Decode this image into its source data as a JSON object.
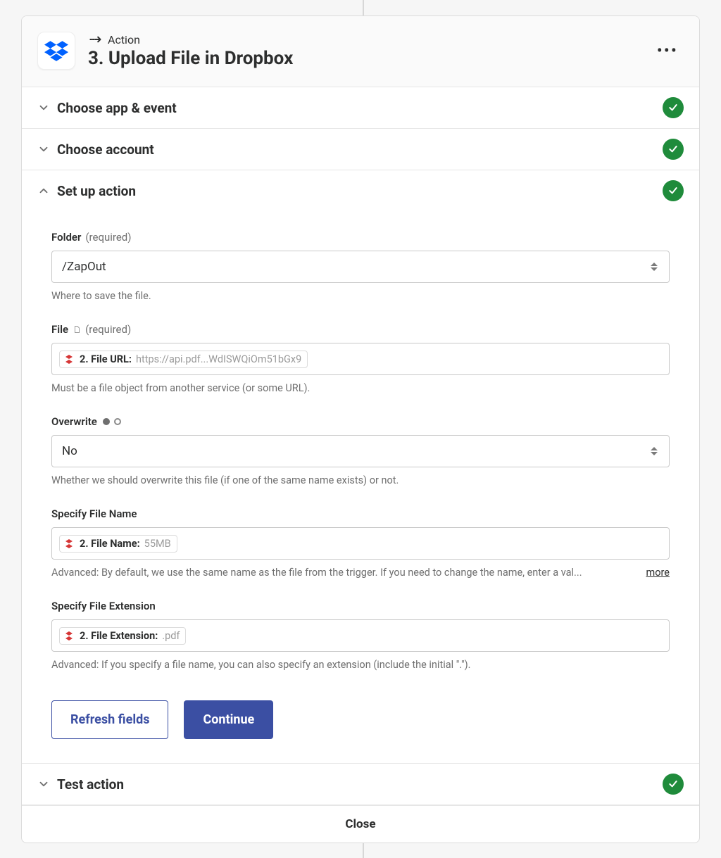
{
  "header": {
    "kind": "Action",
    "title": "3. Upload File in Dropbox",
    "app": "dropbox"
  },
  "sections": {
    "app_event": {
      "label": "Choose app & event",
      "open": false,
      "done": true
    },
    "account": {
      "label": "Choose account",
      "open": false,
      "done": true
    },
    "setup": {
      "label": "Set up action",
      "open": true,
      "done": true
    },
    "test": {
      "label": "Test action",
      "open": false,
      "done": true
    }
  },
  "fields": {
    "folder": {
      "label": "Folder",
      "required_text": "(required)",
      "value": "/ZapOut",
      "hint": "Where to save the file."
    },
    "file": {
      "label": "File",
      "required_text": "(required)",
      "chip_prefix": "2. File URL:",
      "chip_value": "https://api.pdf...WdISWQiOm51bGx9",
      "hint": "Must be a file object from another service (or some URL)."
    },
    "overwrite": {
      "label": "Overwrite",
      "value": "No",
      "hint": "Whether we should overwrite this file (if one of the same name exists) or not."
    },
    "filename": {
      "label": "Specify File Name",
      "chip_prefix": "2. File Name:",
      "chip_value": "55MB",
      "hint": "Advanced: By default, we use the same name as the file from the trigger. If you need to change the name, enter a val...",
      "more": "more"
    },
    "extension": {
      "label": "Specify File Extension",
      "chip_prefix": "2. File Extension:",
      "chip_value": ".pdf",
      "hint": "Advanced: If you specify a file name, you can also specify an extension (include the initial \".\")."
    }
  },
  "buttons": {
    "refresh": "Refresh fields",
    "continue": "Continue"
  },
  "footer": {
    "close": "Close"
  }
}
